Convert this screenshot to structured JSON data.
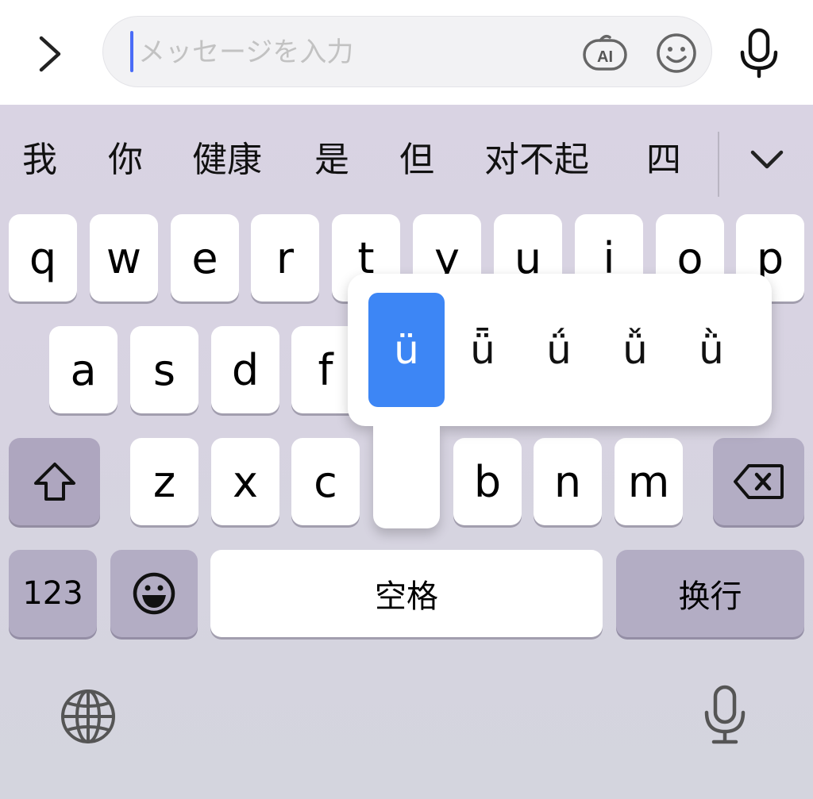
{
  "message_bar": {
    "placeholder": "メッセージを入力",
    "ai_label": "AI"
  },
  "candidates": [
    "我",
    "你",
    "健康",
    "是",
    "但",
    "对不起",
    "四"
  ],
  "keyboard": {
    "row1": [
      "q",
      "w",
      "e",
      "r",
      "t",
      "y",
      "u",
      "i",
      "o",
      "p"
    ],
    "row2": [
      "a",
      "s",
      "d",
      "f"
    ],
    "row3": [
      "z",
      "x",
      "c",
      "b",
      "n",
      "m"
    ],
    "number_key": "123",
    "space_label": "空格",
    "return_label": "换行"
  },
  "accent_popup": {
    "options": [
      "ü",
      "ǖ",
      "ǘ",
      "ǚ",
      "ǜ"
    ],
    "selected_index": 0,
    "selected_color": "#3d86f5"
  },
  "icons": {
    "expand": "chevron-right-icon",
    "ai": "ai-assist-icon",
    "emoji": "smiley-icon",
    "mic": "microphone-icon",
    "collapse": "chevron-down-icon",
    "shift": "shift-arrow-icon",
    "delete": "backspace-icon",
    "emoji_key": "emoji-face-icon",
    "globe": "globe-icon"
  }
}
